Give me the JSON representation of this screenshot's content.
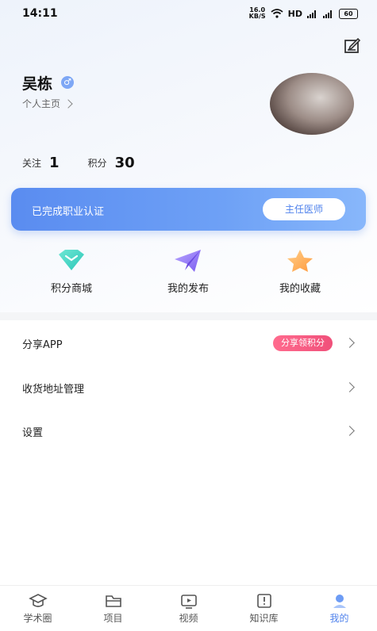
{
  "status_bar": {
    "time": "14:11",
    "net_speed_value": "16.0",
    "net_speed_unit": "KB/S",
    "hd_label": "HD",
    "signal1": "4G",
    "signal2": "4G",
    "battery": "60"
  },
  "profile": {
    "name": "吴栋",
    "gender_symbol": "♂",
    "homepage_link": "个人主页"
  },
  "stats": {
    "following_label": "关注",
    "following_value": "1",
    "points_label": "积分",
    "points_value": "30"
  },
  "certification": {
    "status_text": "已完成职业认证",
    "title_button": "主任医师"
  },
  "quick_actions": [
    {
      "label": "积分商城",
      "icon": "diamond-icon"
    },
    {
      "label": "我的发布",
      "icon": "paper-plane-icon"
    },
    {
      "label": "我的收藏",
      "icon": "star-icon"
    }
  ],
  "menu": {
    "share_label": "分享APP",
    "share_tag": "分享领积分",
    "address_label": "收货地址管理",
    "settings_label": "设置"
  },
  "tabbar": {
    "tabs": [
      {
        "label": "学术圈",
        "icon": "graduation-cap-icon"
      },
      {
        "label": "项目",
        "icon": "folder-icon"
      },
      {
        "label": "视频",
        "icon": "video-icon"
      },
      {
        "label": "知识库",
        "icon": "book-icon"
      },
      {
        "label": "我的",
        "icon": "profile-icon"
      }
    ],
    "active_index": 4
  },
  "colors": {
    "accent": "#4f82ec",
    "share_tag": "#f0507a"
  }
}
